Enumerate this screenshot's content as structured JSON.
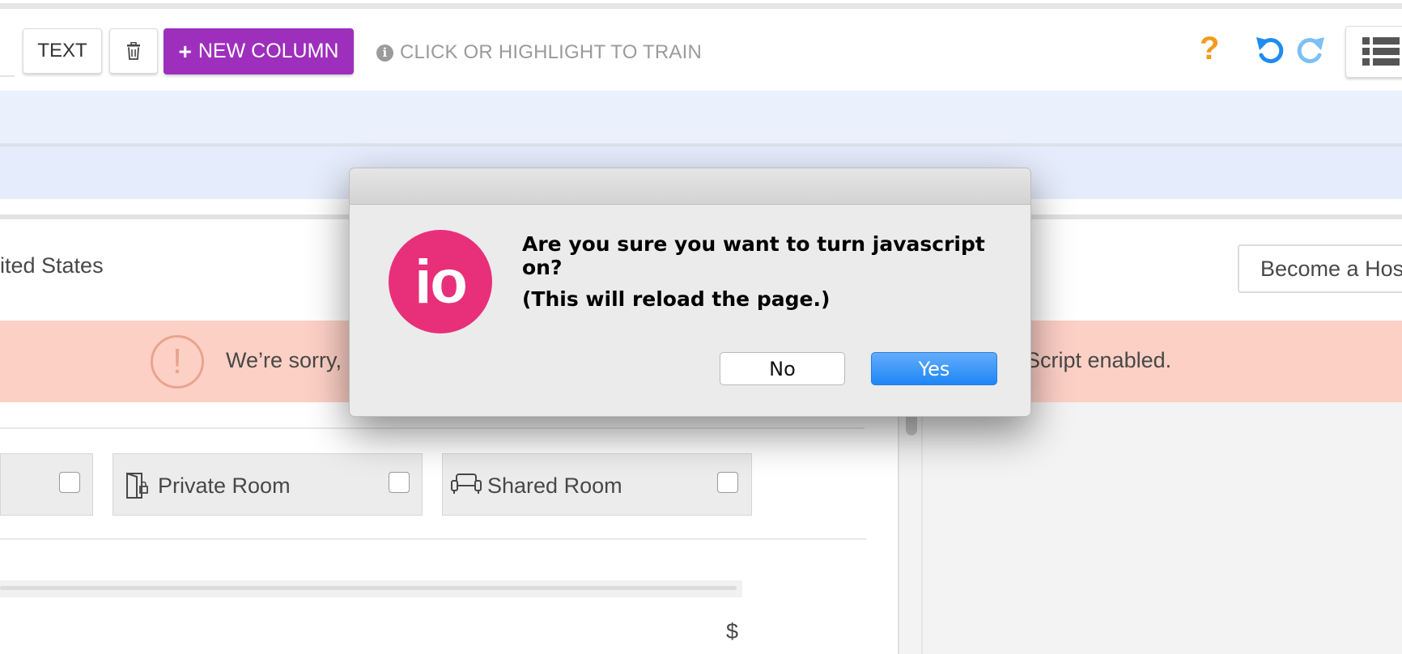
{
  "toolbar": {
    "text_button": "TEXT",
    "trash_icon": "trash-icon",
    "new_column_plus": "+",
    "new_column_label": "NEW COLUMN",
    "train_hint": "CLICK OR HIGHLIGHT TO TRAIN",
    "info_glyph": "i",
    "help_glyph": "?",
    "accent_purple": "#9e2fbd",
    "undo_color": "#1e8cf0"
  },
  "page": {
    "country_text": "ited States",
    "host_button": "Become a Host",
    "warning_glyph": "!",
    "warning_text_left": "We’re sorry,",
    "warning_text_right": "Script enabled.",
    "room_types": [
      {
        "label": "",
        "icon": "home-icon"
      },
      {
        "label": "Private Room",
        "icon": "door-icon"
      },
      {
        "label": "Shared Room",
        "icon": "couch-icon"
      }
    ],
    "currency": "$"
  },
  "dialog": {
    "logo_text": "io",
    "message": "Are you sure you want to turn javascript on?",
    "submessage": "(This will reload the page.)",
    "no_label": "No",
    "yes_label": "Yes",
    "logo_color": "#e8307a"
  }
}
